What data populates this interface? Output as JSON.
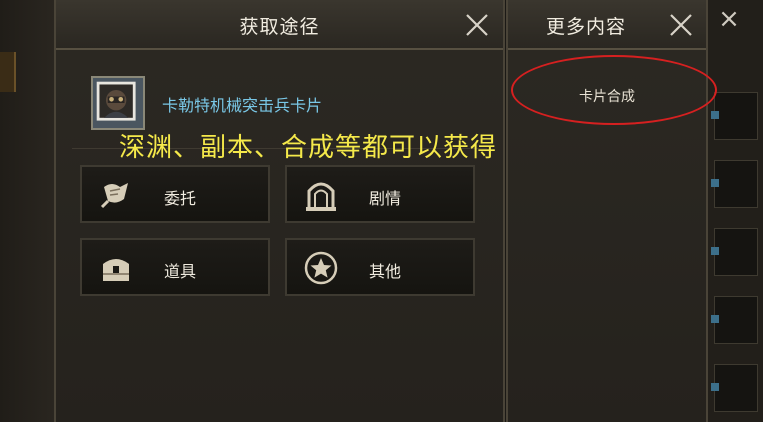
{
  "main_panel": {
    "title": "获取途径",
    "item_name": "卡勒特机械突击兵卡片",
    "sources": [
      {
        "label": "委托",
        "icon": "scroll-icon"
      },
      {
        "label": "剧情",
        "icon": "gate-icon"
      },
      {
        "label": "道具",
        "icon": "chest-icon"
      },
      {
        "label": "其他",
        "icon": "star-icon"
      }
    ]
  },
  "side_panel": {
    "title": "更多内容",
    "items": [
      "卡片合成"
    ]
  },
  "annotation": {
    "text": "深渊、副本、合成等都可以获得",
    "text_color": "#f5e94a",
    "ellipse_color": "#d62020"
  },
  "colors": {
    "item_name": "#79c7e6",
    "panel_bg": "#2a2721"
  }
}
